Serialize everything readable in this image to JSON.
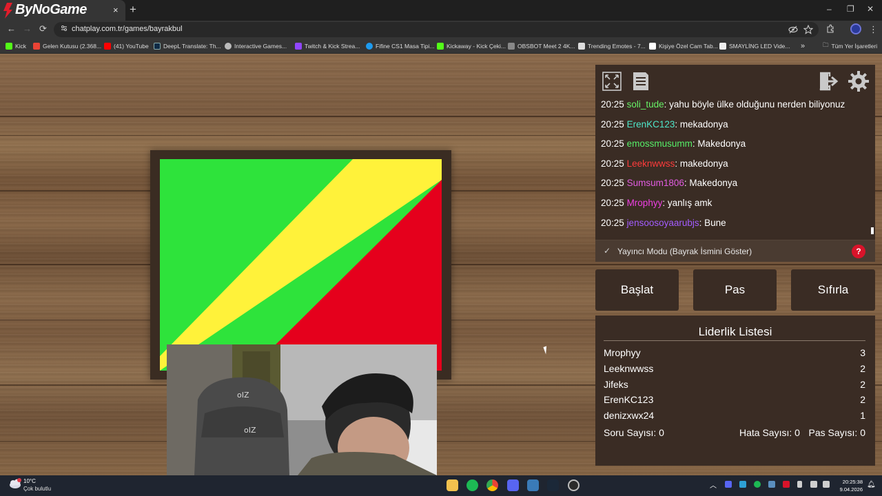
{
  "browser": {
    "tab_title": "ByNoGame",
    "tab_close": "×",
    "new_tab": "+",
    "window_controls": [
      "–",
      "❐",
      "✕"
    ],
    "nav": {
      "back": "←",
      "forward": "→",
      "reload": "⟳"
    },
    "url": "chatplay.com.tr/games/bayrakbul",
    "bookmarks": [
      {
        "label": "Kick",
        "color": "#53fc18"
      },
      {
        "label": "Gelen Kutusu (2.368...",
        "color": "#ea4335"
      },
      {
        "label": "(41) YouTube",
        "color": "#ff0000"
      },
      {
        "label": "DeepL Translate: Th...",
        "color": "#0f2b46"
      },
      {
        "label": "Interactive Games...",
        "color": "#bbbbbb"
      },
      {
        "label": "Twitch & Kick Strea...",
        "color": "#9146ff"
      },
      {
        "label": "Fifine CS1 Masa Tipi...",
        "color": "#1d9bf0"
      },
      {
        "label": "Kickaway - Kick Çeki...",
        "color": "#53fc18"
      },
      {
        "label": "OBSBOT Meet 2 4K...",
        "color": "#888888"
      },
      {
        "label": "Trending Emotes - 7...",
        "color": "#dddddd"
      },
      {
        "label": "Kişiye Özel Cam Tab...",
        "color": "#ffffff"
      },
      {
        "label": "SMAYLİNG LED Vide...",
        "color": "#eeeeee"
      }
    ],
    "bookmarks_overflow": "»",
    "all_bookmarks": "Tüm Yer İşaretleri"
  },
  "game": {
    "flag": {
      "colors": [
        "#2ee33b",
        "#fff23a",
        "#e5001c"
      ]
    }
  },
  "chat": {
    "messages": [
      {
        "time": "20:25",
        "user": "soli_tude",
        "color": "#67f267",
        "text": ": yahu böyle ülke olduğunu nerden biliyonuz"
      },
      {
        "time": "20:25",
        "user": "ErenKC123",
        "color": "#4ee6c9",
        "text": ": mekadonya"
      },
      {
        "time": "20:25",
        "user": "emossmusumm",
        "color": "#56f068",
        "text": ": Makedonya"
      },
      {
        "time": "20:25",
        "user": "Leeknwwss",
        "color": "#ff3b3b",
        "text": ": makedonya"
      },
      {
        "time": "20:25",
        "user": "Sumsum1806",
        "color": "#e25ce2",
        "text": ": Makedonya"
      },
      {
        "time": "20:25",
        "user": "Mrophyy",
        "color": "#ef3fe4",
        "text": ": yanlış amk"
      },
      {
        "time": "20:25",
        "user": "jensoosoyaarubjs",
        "color": "#a35cff",
        "text": ": Bune"
      }
    ],
    "streamer_mode_label": "Yayıncı Modu (Bayrak İsmini Göster)",
    "check_glyph": "✓",
    "help_glyph": "?"
  },
  "controls": {
    "start": "Başlat",
    "pass": "Pas",
    "reset": "Sıfırla"
  },
  "leaderboard": {
    "title": "Liderlik Listesi",
    "rows": [
      {
        "name": "Mrophyy",
        "score": "3"
      },
      {
        "name": "Leeknwwss",
        "score": "2"
      },
      {
        "name": "Jifeks",
        "score": "2"
      },
      {
        "name": "ErenKC123",
        "score": "2"
      },
      {
        "name": "denizxwx24",
        "score": "1"
      }
    ],
    "questions": "Soru Sayısı: 0",
    "errors": "Hata Sayısı: 0",
    "passes": "Pas Sayısı: 0"
  },
  "taskbar": {
    "weather_temp": "10°C",
    "weather_desc": "Çok bulutlu",
    "time": "20:25:38",
    "date": "9.04.2026"
  }
}
